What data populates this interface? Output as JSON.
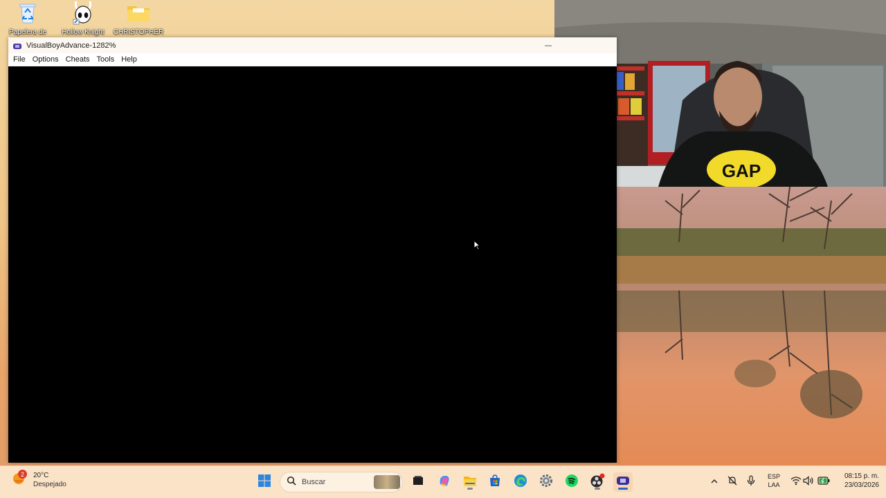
{
  "desktop": {
    "icons": [
      {
        "label": "Papelera de",
        "icon": "recycle-bin-icon"
      },
      {
        "label": "Hollow Knight",
        "icon": "hollow-knight-icon"
      },
      {
        "label": "CHRISTOPHER",
        "icon": "folder-icon"
      }
    ]
  },
  "window": {
    "title": "VisualBoyAdvance-1282%",
    "menu": [
      "File",
      "Options",
      "Cheats",
      "Tools",
      "Help"
    ],
    "minimize_label": "—"
  },
  "taskbar": {
    "weather": {
      "alert_count": "2",
      "temperature": "20°C",
      "condition": "Despejado"
    },
    "search_placeholder": "Buscar",
    "apps": [
      "start-icon",
      "search-icon",
      "task-view-icon",
      "copilot-icon",
      "file-explorer-icon",
      "microsoft-store-icon",
      "edge-icon",
      "settings-icon",
      "spotify-icon",
      "obs-icon",
      "visualboyadvance-icon"
    ],
    "tray": {
      "language_line1": "ESP",
      "language_line2": "LAA",
      "time": "08:15 p. m.",
      "date": "23/03/2026"
    }
  },
  "colors": {
    "accent": "#2a62c7",
    "taskbar_bg": "#fbe3c7",
    "window_bg": "#000000"
  }
}
